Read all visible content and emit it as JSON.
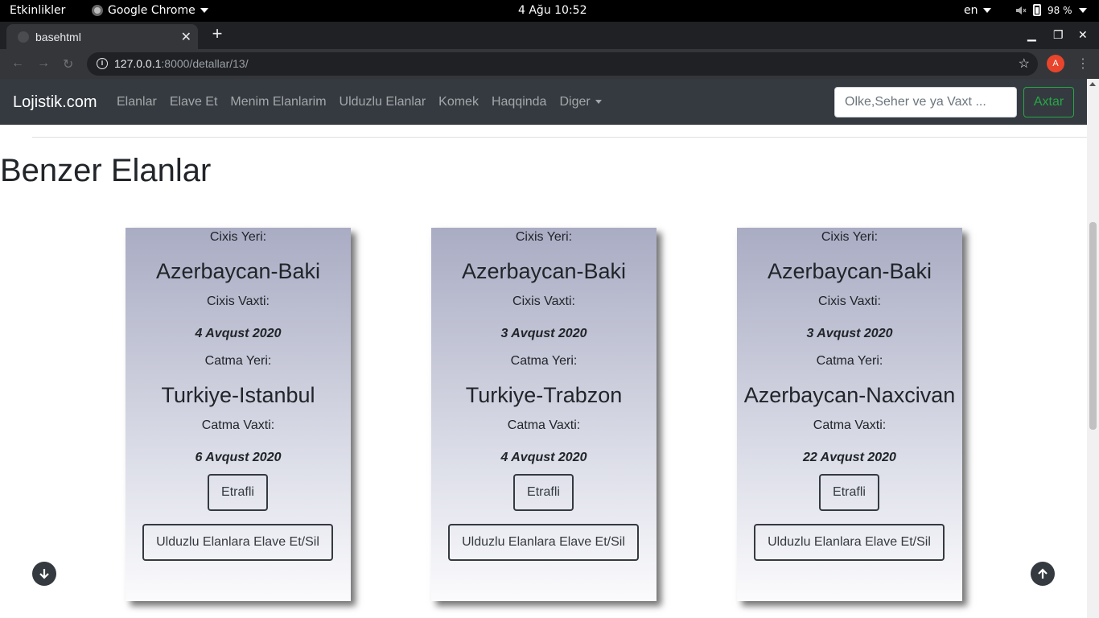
{
  "os": {
    "activities": "Etkinlikler",
    "app_name": "Google Chrome",
    "clock": "4 Ağu  10:52",
    "lang": "en",
    "battery": "98 %"
  },
  "browser": {
    "tab_title": "basehtml",
    "url_host": "127.0.0.1",
    "url_rest": ":8000/detallar/13/",
    "profile_initial": "A"
  },
  "navbar": {
    "brand": "Lojistik.com",
    "links": [
      "Elanlar",
      "Elave Et",
      "Menim Elanlarim",
      "Ulduzlu Elanlar",
      "Komek",
      "Haqqinda",
      "Diger"
    ],
    "search_placeholder": "Olke,Seher ve ya Vaxt ...",
    "search_button": "Axtar"
  },
  "page": {
    "heading": "Benzer Elanlar"
  },
  "card_labels": {
    "departure_place": "Cixis Yeri:",
    "departure_time": "Cixis Vaxti:",
    "arrival_place": "Catma Yeri:",
    "arrival_time": "Catma Vaxti:",
    "details_button": "Etrafli",
    "favorite_button": "Ulduzlu Elanlara Elave Et/Sil"
  },
  "cards": [
    {
      "from": "Azerbaycan-Baki",
      "departure_date": "4 Avqust 2020",
      "to": "Turkiye-Istanbul",
      "arrival_date": "6 Avqust 2020"
    },
    {
      "from": "Azerbaycan-Baki",
      "departure_date": "3 Avqust 2020",
      "to": "Turkiye-Trabzon",
      "arrival_date": "4 Avqust 2020"
    },
    {
      "from": "Azerbaycan-Baki",
      "departure_date": "3 Avqust 2020",
      "to": "Azerbaycan-Naxcivan",
      "arrival_date": "22 Avqust 2020"
    }
  ]
}
